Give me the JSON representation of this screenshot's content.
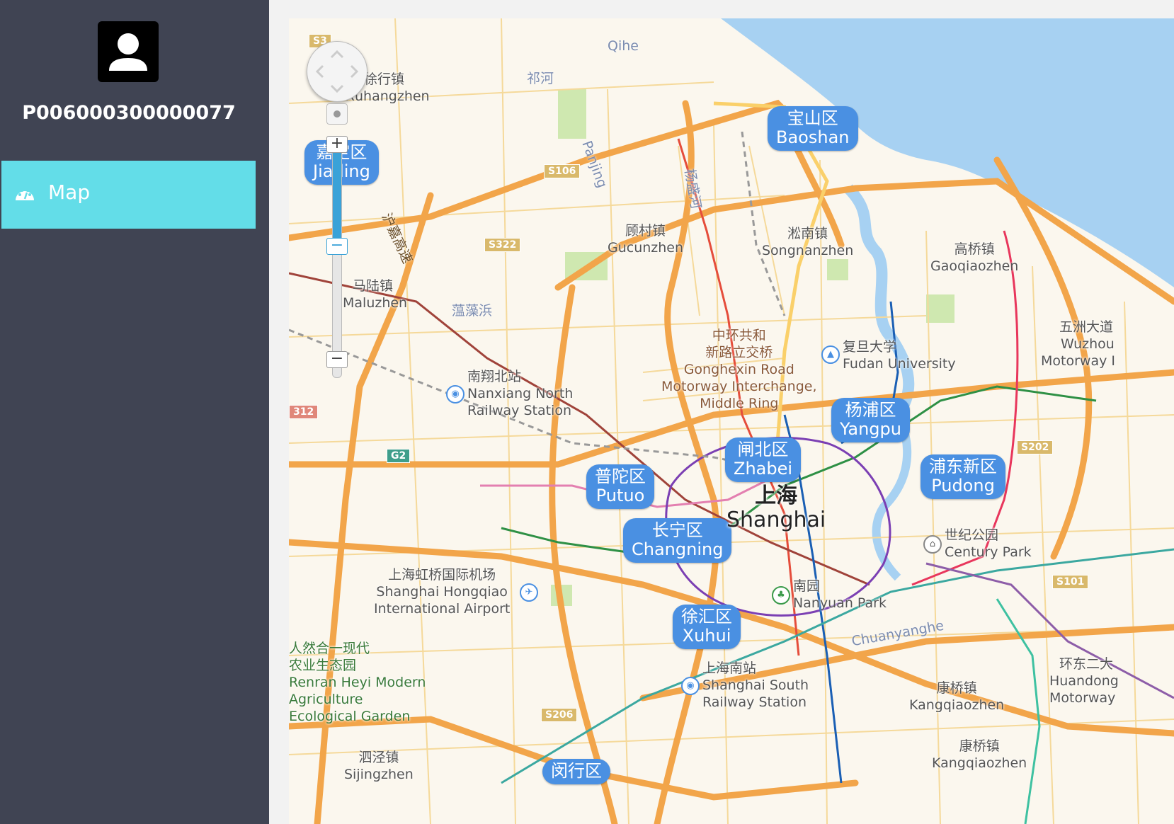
{
  "sidebar": {
    "user_id": "P006000300000077",
    "avatar_icon": "person-icon",
    "nav": [
      {
        "label": "Map",
        "icon": "dashboard-gauge-icon",
        "active": true
      }
    ],
    "bg_color": "#404453",
    "active_color": "#63dde8"
  },
  "map": {
    "controls": {
      "pan_icon": "pan-control-icon",
      "zoom_in": "+",
      "zoom_out": "−",
      "zoom_min": "−"
    },
    "districts": {
      "baoshan": {
        "cn": "宝山区",
        "en": "Baoshan"
      },
      "jiading": {
        "cn": "嘉定区",
        "en": "Jiading"
      },
      "yangpu": {
        "cn": "杨浦区",
        "en": "Yangpu"
      },
      "zhabei": {
        "cn": "闸北区",
        "en": "Zhabei"
      },
      "pudong": {
        "cn": "浦东新区",
        "en": "Pudong"
      },
      "putuo": {
        "cn": "普陀区",
        "en": "Putuo"
      },
      "changning": {
        "cn": "长宁区",
        "en": "Changning"
      },
      "xuhui": {
        "cn": "徐汇区",
        "en": "Xuhui"
      },
      "minhang": {
        "cn": "闵行区"
      }
    },
    "city": {
      "cn": "上海",
      "en": "Shanghai"
    },
    "places": {
      "xuhangzhen": {
        "cn": "徐行镇",
        "en": "Xuhangzhen"
      },
      "gucunzhen": {
        "cn": "顾村镇",
        "en": "Gucunzhen"
      },
      "songnanzhen": {
        "cn": "淞南镇",
        "en": "Songnanzhen"
      },
      "gaoqiaozhen": {
        "cn": "高桥镇",
        "en": "Gaoqiaozhen"
      },
      "maluzhen": {
        "cn": "马陆镇",
        "en": "Maluzhen"
      },
      "gonghexin": {
        "cn1": "中环共和",
        "cn2": "新路立交桥",
        "en1": "Gonghexin Road",
        "en2": "Motorway Interchange,",
        "en3": "Middle Ring"
      },
      "fudan": {
        "cn": "复旦大学",
        "en": "Fudan University"
      },
      "nanxiang": {
        "cn": "南翔北站",
        "en1": "Nanxiang North",
        "en2": "Railway Station"
      },
      "wuzhou": {
        "cn": "五洲大道",
        "en1": "Wuzhou",
        "en2": "Motorway I"
      },
      "century_park": {
        "cn": "世纪公园",
        "en": "Century Park"
      },
      "hongqiao": {
        "cn": "上海虹桥国际机场",
        "en1": "Shanghai Hongqiao",
        "en2": "International Airport"
      },
      "nanyuan": {
        "cn": "南园",
        "en": "Nanyuan Park"
      },
      "renran": {
        "cn1": "人然合一现代",
        "cn2": "农业生态园",
        "en1": "Renran Heyi Modern",
        "en2": "Agriculture",
        "en3": "Ecological Garden"
      },
      "shanghai_south": {
        "cn": "上海南站",
        "en1": "Shanghai South",
        "en2": "Railway Station"
      },
      "kangqiao1": {
        "cn": "康桥镇",
        "en": "Kangqiaozhen"
      },
      "kangqiao2": {
        "cn": "康桥镇",
        "en": "Kangqiaozhen"
      },
      "huandong": {
        "cn": "环东二大",
        "en1": "Huandong",
        "en2": "Motorway"
      },
      "sijing": {
        "cn": "泗泾镇",
        "en": "Sijingzhen"
      }
    },
    "roads": {
      "qihe": "Qihe",
      "qihe_cn": "祁河",
      "panjing": "Panjing",
      "yangsheng": "杨盛河",
      "hujia": "沪嘉高速",
      "yunzao": "蕰藻浜",
      "chuanyang": "Chuanyanghe"
    },
    "shields": {
      "s106": "S106",
      "s322": "S322",
      "g2": "G2",
      "s202": "S202",
      "s101": "S101",
      "s206": "S206",
      "s312": "312",
      "s3": "S3"
    }
  }
}
